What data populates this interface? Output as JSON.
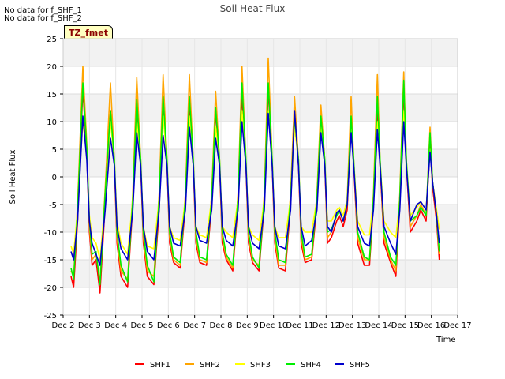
{
  "notes": [
    "No data for f_SHF_1",
    "No data for f_SHF_2"
  ],
  "badge": "TZ_fmet",
  "chart_data": {
    "type": "line",
    "title": "Soil Heat Flux",
    "xlabel": "Time",
    "ylabel": "Soil Heat Flux",
    "xlim": [
      2,
      17
    ],
    "ylim": [
      -25,
      25
    ],
    "x_ticks": [
      2,
      3,
      4,
      5,
      6,
      7,
      8,
      9,
      10,
      11,
      12,
      13,
      14,
      15,
      16,
      17
    ],
    "x_tick_labels": [
      "Dec 2",
      "Dec 3",
      "Dec 4",
      "Dec 5",
      "Dec 6",
      "Dec 7",
      "Dec 8",
      "Dec 9",
      "Dec 10",
      "Dec 11",
      "Dec 12",
      "Dec 13",
      "Dec 14",
      "Dec 15",
      "Dec 16",
      "Dec 17"
    ],
    "y_ticks": [
      -25,
      -20,
      -15,
      -10,
      -5,
      0,
      5,
      10,
      15,
      20,
      25
    ],
    "grid": true,
    "legend_position": "bottom-center",
    "series": [
      {
        "name": "SHF1",
        "color": "#ff0000",
        "x": [
          2.3,
          2.4,
          2.55,
          2.75,
          2.9,
          3.0,
          3.1,
          3.25,
          3.4,
          3.6,
          3.8,
          3.95,
          4.05,
          4.2,
          4.45,
          4.65,
          4.8,
          4.95,
          5.05,
          5.2,
          5.45,
          5.65,
          5.8,
          5.95,
          6.05,
          6.2,
          6.45,
          6.65,
          6.8,
          6.95,
          7.05,
          7.2,
          7.45,
          7.65,
          7.8,
          7.95,
          8.05,
          8.2,
          8.45,
          8.65,
          8.8,
          8.95,
          9.05,
          9.2,
          9.45,
          9.65,
          9.8,
          9.95,
          10.05,
          10.2,
          10.45,
          10.65,
          10.8,
          10.95,
          11.05,
          11.2,
          11.45,
          11.65,
          11.8,
          11.95,
          12.05,
          12.2,
          12.4,
          12.5,
          12.65,
          12.8,
          12.95,
          13.05,
          13.2,
          13.45,
          13.65,
          13.8,
          13.95,
          14.05,
          14.2,
          14.45,
          14.65,
          14.8,
          14.95,
          15.05,
          15.2,
          15.45,
          15.6,
          15.8,
          15.95,
          16.05,
          16.2,
          16.3
        ],
        "y": [
          -18,
          -20,
          -8,
          16,
          4,
          -10,
          -16,
          -15,
          -21,
          -5,
          12,
          2,
          -12,
          -18,
          -20,
          -5,
          13,
          2,
          -12,
          -18,
          -19.5,
          -6,
          14,
          2,
          -12,
          -15.5,
          -16.5,
          -5,
          13,
          2,
          -12,
          -15.5,
          -16,
          -5,
          12,
          2,
          -12,
          -15,
          -17,
          -5,
          15,
          2,
          -12,
          -15.5,
          -17,
          -5,
          16,
          2,
          -12,
          -16.5,
          -17,
          -5,
          11,
          2,
          -12,
          -15.5,
          -15,
          -5,
          10,
          2,
          -12,
          -11,
          -8,
          -7,
          -9,
          -6,
          10,
          2,
          -12,
          -16,
          -16,
          -5,
          13,
          2,
          -12,
          -15.5,
          -18,
          -5,
          16,
          2,
          -10,
          -8,
          -6,
          -8,
          6,
          -2,
          -8,
          -15
        ]
      },
      {
        "name": "SHF2",
        "color": "#ffa500",
        "x": [
          2.3,
          2.4,
          2.55,
          2.75,
          2.9,
          3.0,
          3.1,
          3.25,
          3.4,
          3.6,
          3.8,
          3.95,
          4.05,
          4.2,
          4.45,
          4.65,
          4.8,
          4.95,
          5.05,
          5.2,
          5.45,
          5.65,
          5.8,
          5.95,
          6.05,
          6.2,
          6.45,
          6.65,
          6.8,
          6.95,
          7.05,
          7.2,
          7.45,
          7.65,
          7.8,
          7.95,
          8.05,
          8.2,
          8.45,
          8.65,
          8.8,
          8.95,
          9.05,
          9.2,
          9.45,
          9.65,
          9.8,
          9.95,
          10.05,
          10.2,
          10.45,
          10.65,
          10.8,
          10.95,
          11.05,
          11.2,
          11.45,
          11.65,
          11.8,
          11.95,
          12.05,
          12.2,
          12.4,
          12.5,
          12.65,
          12.8,
          12.95,
          13.05,
          13.2,
          13.45,
          13.65,
          13.8,
          13.95,
          14.05,
          14.2,
          14.45,
          14.65,
          14.8,
          14.95,
          15.05,
          15.2,
          15.45,
          15.6,
          15.8,
          15.95,
          16.05,
          16.2,
          16.3
        ],
        "y": [
          -17,
          -18,
          -5,
          20,
          6,
          -9,
          -15,
          -14,
          -19,
          -2,
          17,
          3,
          -11,
          -17,
          -18.5,
          -3,
          18,
          3,
          -11,
          -17,
          -18,
          -3,
          18.5,
          3,
          -11,
          -15,
          -16,
          -3,
          18.5,
          3,
          -11,
          -15,
          -15.5,
          -3,
          15.5,
          3,
          -11,
          -14.5,
          -16.5,
          -3,
          20,
          3,
          -11,
          -15,
          -16,
          -3,
          21.5,
          3,
          -11,
          -16,
          -16,
          -3,
          14.5,
          3,
          -11,
          -15,
          -14.5,
          -3,
          13,
          3,
          -11,
          -10,
          -7,
          -6,
          -8,
          -4,
          14.5,
          3,
          -11,
          -15,
          -15,
          -3,
          18.5,
          3,
          -11,
          -15,
          -17,
          -3,
          19,
          3,
          -9,
          -7,
          -5,
          -7,
          9,
          -1,
          -7,
          -14
        ]
      },
      {
        "name": "SHF3",
        "color": "#ffff00",
        "x": [
          2.3,
          2.4,
          2.55,
          2.75,
          2.9,
          3.0,
          3.1,
          3.25,
          3.4,
          3.6,
          3.8,
          3.95,
          4.05,
          4.2,
          4.45,
          4.65,
          4.8,
          4.95,
          5.05,
          5.2,
          5.45,
          5.65,
          5.8,
          5.95,
          6.05,
          6.2,
          6.45,
          6.65,
          6.8,
          6.95,
          7.05,
          7.2,
          7.45,
          7.65,
          7.8,
          7.95,
          8.05,
          8.2,
          8.45,
          8.65,
          8.8,
          8.95,
          9.05,
          9.2,
          9.45,
          9.65,
          9.8,
          9.95,
          10.05,
          10.2,
          10.45,
          10.65,
          10.8,
          10.95,
          11.05,
          11.2,
          11.45,
          11.65,
          11.8,
          11.95,
          12.05,
          12.2,
          12.4,
          12.5,
          12.65,
          12.8,
          12.95,
          13.05,
          13.2,
          13.45,
          13.65,
          13.8,
          13.95,
          14.05,
          14.2,
          14.45,
          14.65,
          14.8,
          14.95,
          15.05,
          15.2,
          15.45,
          15.6,
          15.8,
          15.95,
          16.05,
          16.2,
          16.3
        ],
        "y": [
          -12.5,
          -14,
          -6,
          10,
          4,
          -7,
          -11,
          -12,
          -15,
          -4,
          10,
          3,
          -8,
          -12,
          -14,
          -4,
          10,
          3,
          -9,
          -12.5,
          -13,
          -4,
          11,
          3,
          -9,
          -11,
          -11.5,
          -4,
          11,
          3,
          -9,
          -10.5,
          -11,
          -4,
          9,
          3,
          -9,
          -10,
          -11,
          -4,
          12,
          3,
          -9,
          -10.5,
          -11.5,
          -4,
          12,
          3,
          -9,
          -11,
          -11,
          -4,
          9,
          3,
          -9,
          -10,
          -10,
          -4,
          9,
          3,
          -8,
          -8,
          -6,
          -5.5,
          -7,
          -4,
          9,
          3,
          -8,
          -10.5,
          -10.5,
          -4,
          10,
          3,
          -8,
          -10,
          -11,
          -4,
          12,
          3,
          -7,
          -5.5,
          -4.5,
          -6,
          5,
          -1,
          -6,
          -9.5
        ]
      },
      {
        "name": "SHF4",
        "color": "#00ee00",
        "x": [
          2.3,
          2.4,
          2.55,
          2.75,
          2.9,
          3.0,
          3.1,
          3.25,
          3.4,
          3.6,
          3.8,
          3.95,
          4.05,
          4.2,
          4.45,
          4.65,
          4.8,
          4.95,
          5.05,
          5.2,
          5.45,
          5.65,
          5.8,
          5.95,
          6.05,
          6.2,
          6.45,
          6.65,
          6.8,
          6.95,
          7.05,
          7.2,
          7.45,
          7.65,
          7.8,
          7.95,
          8.05,
          8.2,
          8.45,
          8.65,
          8.8,
          8.95,
          9.05,
          9.2,
          9.45,
          9.65,
          9.8,
          9.95,
          10.05,
          10.2,
          10.45,
          10.65,
          10.8,
          10.95,
          11.05,
          11.2,
          11.45,
          11.65,
          11.8,
          11.95,
          12.05,
          12.2,
          12.4,
          12.5,
          12.65,
          12.8,
          12.95,
          13.05,
          13.2,
          13.45,
          13.65,
          13.8,
          13.95,
          14.05,
          14.2,
          14.45,
          14.65,
          14.8,
          14.95,
          15.05,
          15.2,
          15.45,
          15.6,
          15.8,
          15.95,
          16.05,
          16.2,
          16.3
        ],
        "y": [
          -16.5,
          -18.5,
          -6,
          17,
          5,
          -8,
          -14,
          -13.5,
          -19.5,
          -3,
          12,
          3,
          -10,
          -16,
          -19,
          -4,
          14,
          3,
          -10,
          -16,
          -19,
          -4,
          14.5,
          3,
          -10,
          -14.5,
          -15.5,
          -4,
          14.5,
          3,
          -10,
          -14.5,
          -15,
          -4,
          12.5,
          3,
          -10,
          -14,
          -16,
          -4,
          17,
          3,
          -10,
          -14.5,
          -16.5,
          -4,
          17,
          3,
          -10,
          -15,
          -15.5,
          -4,
          11,
          3,
          -10,
          -14.5,
          -14,
          -4,
          11,
          3,
          -10,
          -9.5,
          -7,
          -6,
          -8,
          -5,
          11,
          3,
          -10,
          -14.5,
          -15,
          -4,
          14.5,
          3,
          -10,
          -14.5,
          -16,
          -4,
          17.5,
          3,
          -8,
          -7,
          -5.5,
          -7,
          8,
          -1,
          -7,
          -13.5
        ]
      },
      {
        "name": "SHF5",
        "color": "#0000cc",
        "x": [
          2.3,
          2.4,
          2.55,
          2.75,
          2.9,
          3.0,
          3.1,
          3.25,
          3.4,
          3.6,
          3.8,
          3.95,
          4.05,
          4.2,
          4.45,
          4.65,
          4.8,
          4.95,
          5.05,
          5.2,
          5.45,
          5.65,
          5.8,
          5.95,
          6.05,
          6.2,
          6.45,
          6.65,
          6.8,
          6.95,
          7.05,
          7.2,
          7.45,
          7.65,
          7.8,
          7.95,
          8.05,
          8.2,
          8.45,
          8.65,
          8.8,
          8.95,
          9.05,
          9.2,
          9.45,
          9.65,
          9.8,
          9.95,
          10.05,
          10.2,
          10.45,
          10.65,
          10.8,
          10.95,
          11.05,
          11.2,
          11.45,
          11.65,
          11.8,
          11.95,
          12.05,
          12.2,
          12.4,
          12.5,
          12.65,
          12.8,
          12.95,
          13.05,
          13.2,
          13.45,
          13.65,
          13.8,
          13.95,
          14.05,
          14.2,
          14.45,
          14.65,
          14.8,
          14.95,
          15.05,
          15.2,
          15.45,
          15.6,
          15.8,
          15.95,
          16.05,
          16.2,
          16.3
        ],
        "y": [
          -13.5,
          -15,
          -8,
          11,
          3,
          -8,
          -12,
          -14,
          -16,
          -6,
          7,
          2,
          -9,
          -13,
          -15,
          -6,
          8,
          2,
          -9,
          -13.5,
          -15,
          -6,
          7.5,
          2,
          -9,
          -12,
          -12.5,
          -6,
          9,
          2,
          -9,
          -11.5,
          -12,
          -6,
          7,
          2,
          -9,
          -11.5,
          -12.5,
          -6,
          10,
          2,
          -9,
          -12,
          -13,
          -6,
          11.5,
          2,
          -9,
          -12.5,
          -13,
          -6,
          12,
          2,
          -9,
          -12.5,
          -11.5,
          -6,
          8,
          2,
          -9,
          -10,
          -6.5,
          -6,
          -8,
          -5,
          8,
          2,
          -9,
          -12,
          -12.5,
          -6,
          8.5,
          2,
          -9,
          -12,
          -14,
          -6,
          10,
          2,
          -8,
          -5,
          -4.5,
          -6,
          4.5,
          -1,
          -7,
          -12
        ]
      }
    ]
  }
}
